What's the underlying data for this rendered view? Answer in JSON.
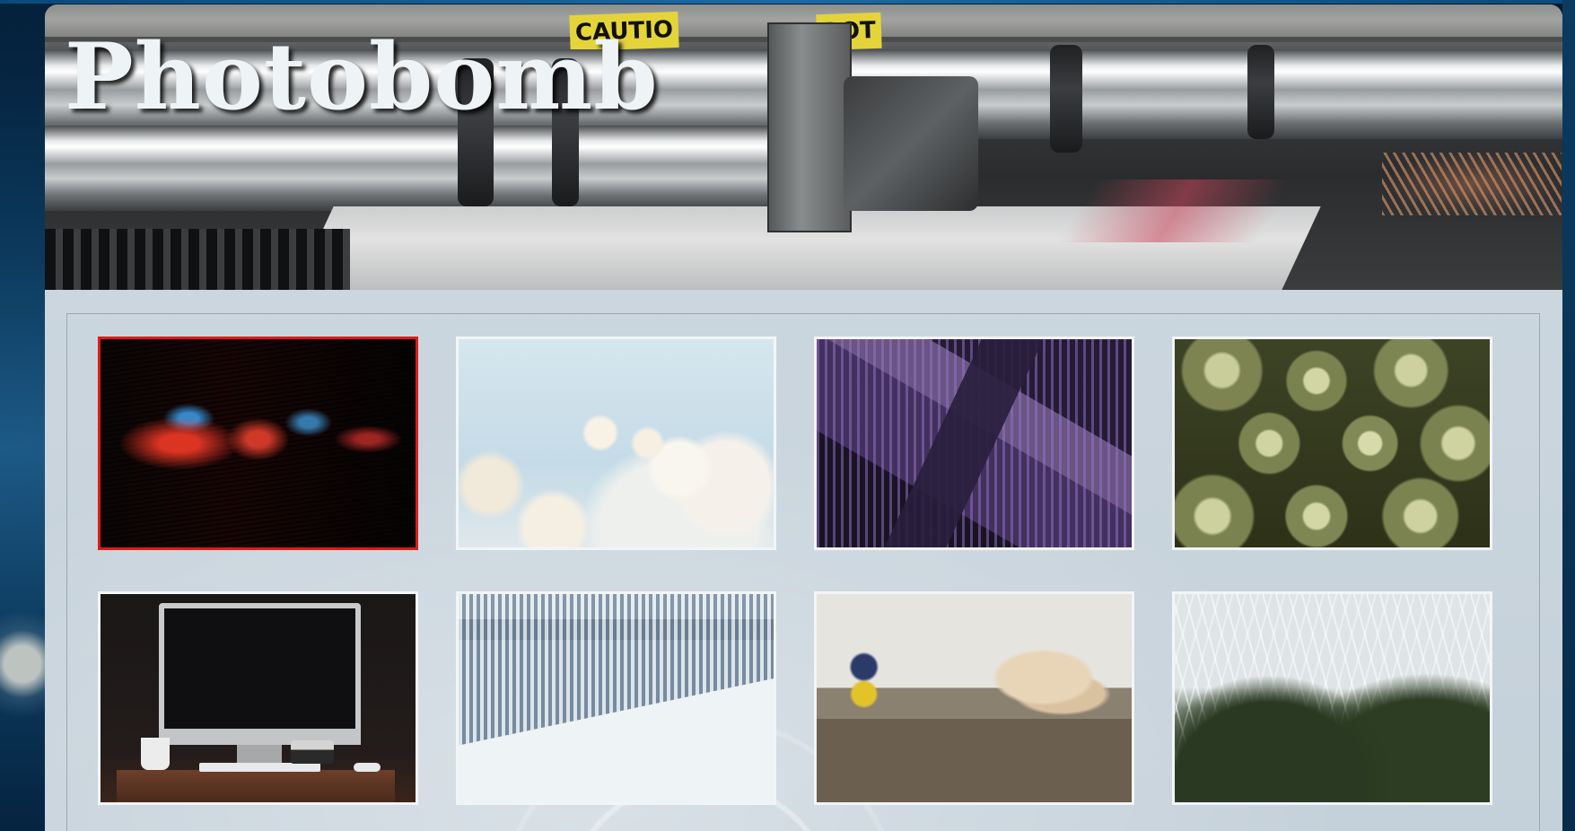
{
  "site": {
    "title": "Photobomb"
  },
  "banner": {
    "image": "printing-press-rollers",
    "signs": [
      "CAUTIO",
      "ROT"
    ]
  },
  "gallery": {
    "selected_index": 0,
    "accent_color": "#e01a1a",
    "thumbnails": [
      {
        "subject": "red and blue neon light streaks"
      },
      {
        "subject": "white magnolia blossoms against sky"
      },
      {
        "subject": "purple skyscrapers looking up"
      },
      {
        "subject": "green succulent plants"
      },
      {
        "subject": "iMac on wooden desk with mug and camera"
      },
      {
        "subject": "frozen waterfall in snow"
      },
      {
        "subject": "woodworking bench with drill and guitar bodies"
      },
      {
        "subject": "glass greenhouse with tropical plants"
      }
    ]
  }
}
